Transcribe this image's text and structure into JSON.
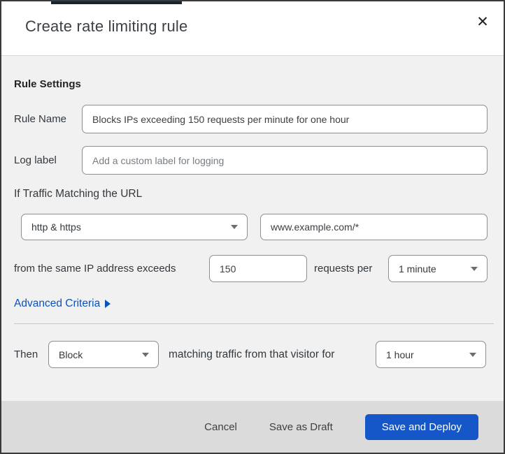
{
  "modal": {
    "title": "Create rate limiting rule",
    "close_icon": "✕"
  },
  "body": {
    "section_heading": "Rule Settings",
    "rule_name": {
      "label": "Rule Name",
      "value": "Blocks IPs exceeding 150 requests per minute for one hour"
    },
    "log_label": {
      "label": "Log label",
      "placeholder": "Add a custom label for logging"
    },
    "traffic_heading": "If Traffic Matching the URL",
    "scheme_select": {
      "value": "http & https"
    },
    "url_input": {
      "value": "www.example.com/*"
    },
    "threshold": {
      "prefix": "from the same IP address exceeds",
      "count_value": "150",
      "middle": "requests per",
      "period_value": "1 minute"
    },
    "advanced_link": "Advanced Criteria",
    "then_row": {
      "label": "Then",
      "action_value": "Block",
      "middle": "matching traffic from that visitor for",
      "duration_value": "1 hour"
    }
  },
  "footer": {
    "cancel": "Cancel",
    "save_draft": "Save as Draft",
    "save_deploy": "Save and Deploy"
  },
  "colors": {
    "link_blue": "#0a51c2",
    "primary_button_blue": "#1556c8",
    "top_accent_bar": "#16242f",
    "body_background": "#f1f1f1",
    "footer_background": "#dbdbdb"
  }
}
